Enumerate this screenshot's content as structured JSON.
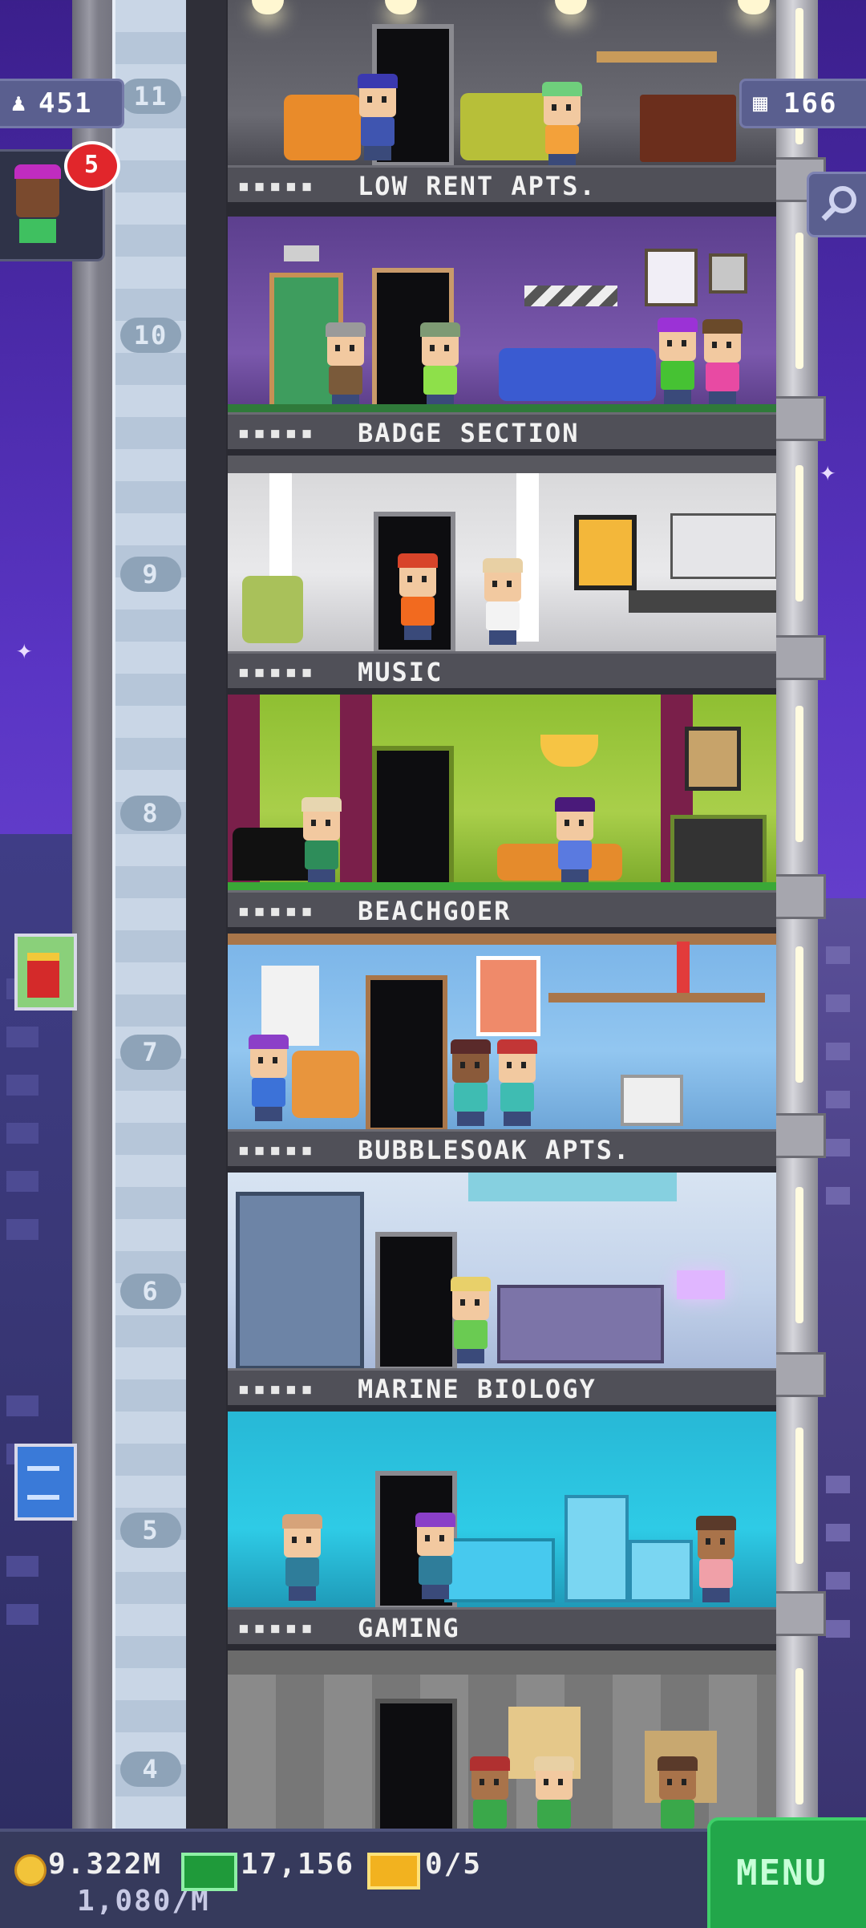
{
  "hud": {
    "population": "451",
    "floors_count": "166",
    "notification_count": "5"
  },
  "floors": [
    {
      "number": "11",
      "name": "LOW RENT APTS.",
      "stars": "▪▪▪▪▪"
    },
    {
      "number": "10",
      "name": "BADGE SECTION",
      "stars": "▪▪▪▪▪"
    },
    {
      "number": "9",
      "name": "MUSIC",
      "stars": "▪▪▪▪▪"
    },
    {
      "number": "8",
      "name": "BEACHGOER",
      "stars": "▪▪▪▪▪"
    },
    {
      "number": "7",
      "name": "BUBBLESOAK APTS.",
      "stars": "▪▪▪▪▪"
    },
    {
      "number": "6",
      "name": "MARINE BIOLOGY",
      "stars": "▪▪▪▪▪"
    },
    {
      "number": "5",
      "name": "GAMING",
      "stars": "▪▪▪▪▪"
    },
    {
      "number": "4",
      "name": "",
      "stars": ""
    }
  ],
  "bottom": {
    "coins": "9.322M",
    "coins_rate": "1,080/M",
    "bux": "17,156",
    "tickets": "0/5",
    "menu_label": "MENU"
  },
  "icons": {
    "population": "person-icon",
    "floors": "building-icon",
    "search": "magnifier-icon",
    "coin": "coin-icon",
    "bux": "bux-icon",
    "ticket": "ticket-icon"
  },
  "colors": {
    "menu_green": "#22a64a",
    "notif_red": "#e1262b",
    "hud_bg": "#363a5c"
  }
}
